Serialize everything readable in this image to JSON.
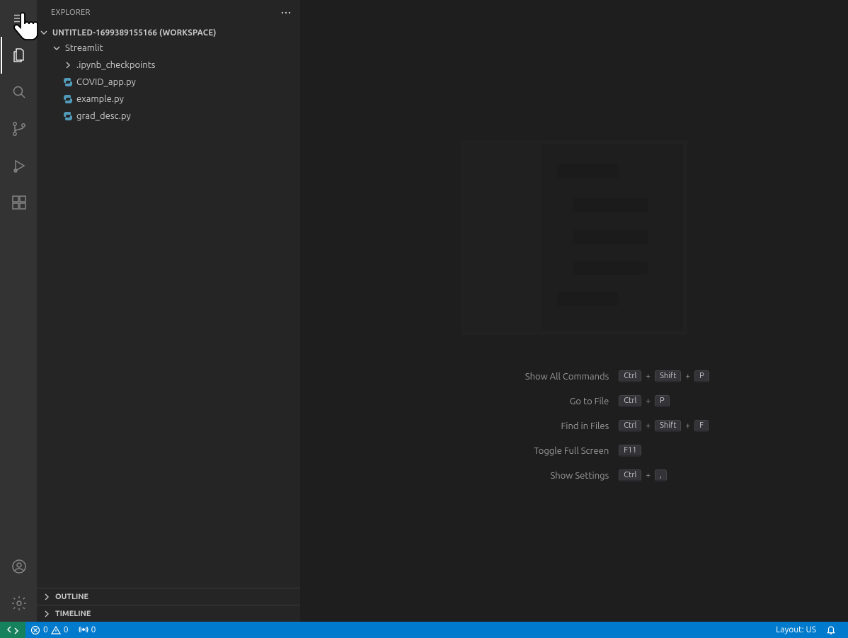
{
  "activityBar": {
    "items": [
      "explorer",
      "search",
      "source-control",
      "run-debug",
      "extensions"
    ],
    "bottom": [
      "accounts",
      "settings-gear"
    ]
  },
  "sidebar": {
    "title": "EXPLORER",
    "workspace": {
      "name": "UNTITLED-1699389155166",
      "suffix": "(WORKSPACE)"
    },
    "rootFolder": {
      "name": "Streamlit",
      "expanded": true
    },
    "items": [
      {
        "type": "folder",
        "name": ".ipynb_checkpoints",
        "expanded": false
      },
      {
        "type": "file",
        "name": "COVID_app.py",
        "lang": "python"
      },
      {
        "type": "file",
        "name": "example.py",
        "lang": "python"
      },
      {
        "type": "file",
        "name": "grad_desc.py",
        "lang": "python"
      }
    ],
    "collapsedSections": [
      "OUTLINE",
      "TIMELINE"
    ]
  },
  "editor": {
    "shortcuts": [
      {
        "label": "Show All Commands",
        "keys": [
          "Ctrl",
          "Shift",
          "P"
        ]
      },
      {
        "label": "Go to File",
        "keys": [
          "Ctrl",
          "P"
        ]
      },
      {
        "label": "Find in Files",
        "keys": [
          "Ctrl",
          "Shift",
          "F"
        ]
      },
      {
        "label": "Toggle Full Screen",
        "keys": [
          "F11"
        ]
      },
      {
        "label": "Show Settings",
        "keys": [
          "Ctrl",
          ","
        ]
      }
    ]
  },
  "statusBar": {
    "errors": "0",
    "warnings": "0",
    "ports": "0",
    "layout": "Layout: US"
  }
}
